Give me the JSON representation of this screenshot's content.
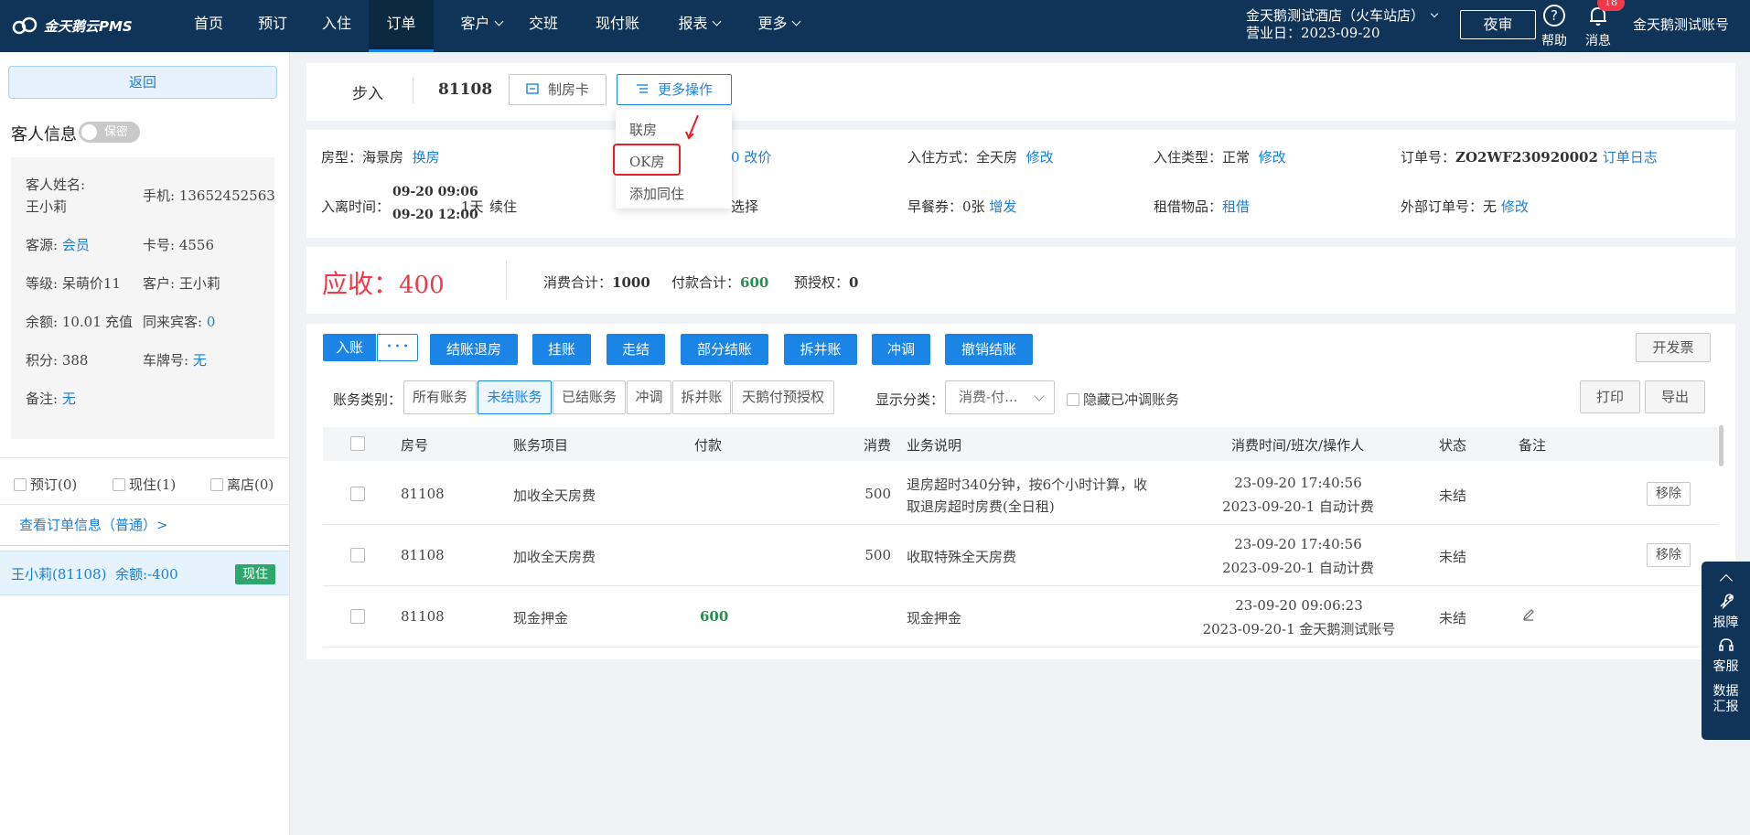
{
  "nav": {
    "logo": "金天鹅云PMS",
    "items": [
      "首页",
      "预订",
      "入住",
      "订单",
      "客户",
      "交班",
      "现付账",
      "报表",
      "更多"
    ],
    "active": "订单",
    "hotel_name": "金天鹅测试酒店（火车站店）",
    "business_date": "营业日：2023-09-20",
    "night_audit": "夜审",
    "help": "帮助",
    "messages": "消息",
    "message_count": "18",
    "account": "金天鹅测试账号"
  },
  "left": {
    "back": "返回",
    "guest_info_title": "客人信息",
    "privacy": "保密",
    "guest_name_label": "客人姓名:",
    "guest_name": "王小莉",
    "phone": "手机: 13652452563",
    "source_label": "客源:",
    "source": "会员",
    "card": "卡号: 4556",
    "level": "等级: 呆萌价11",
    "customer": "客户: 王小莉",
    "balance": "余额: 10.01",
    "recharge": "充值",
    "companions_label": "同来宾客:",
    "companions": "0",
    "points": "积分: 388",
    "plate_label": "车牌号:",
    "plate": "无",
    "remark_label": "备注:",
    "remark": "无",
    "filters": [
      "预订(0)",
      "现住(1)",
      "离店(0)"
    ],
    "view_order": "查看订单信息（普通）>",
    "room_entry": "王小莉(81108)  余额:-400",
    "room_status": "现住"
  },
  "header": {
    "walk_in": "步入",
    "room_no": "81108",
    "make_card": "制房卡",
    "more_ops": "更多操作"
  },
  "menu": {
    "items": [
      "联房",
      "OK房",
      "添加同住"
    ]
  },
  "details": {
    "room_type_label": "房型：",
    "room_type": "海景房",
    "change_room": "换房",
    "price_partial": "0",
    "change_price": "改价",
    "checkin_method_label": "入住方式：",
    "checkin_method": "全天房",
    "checkin_type_label": "入住类型：",
    "checkin_type": "正常",
    "modify": "修改",
    "order_no_label": "订单号：",
    "order_no": "ZO2WF230920002",
    "order_log": "订单日志",
    "stay_label": "入离时间：",
    "stay_in": "09-20 09:06",
    "stay_out": "09-20 12:00",
    "nights": "1天",
    "extend": "续住",
    "select": "选择",
    "breakfast_label": "早餐券：",
    "breakfast": "0张",
    "issue": "增发",
    "rental_label": "租借物品：",
    "rent": "租借",
    "external_label": "外部订单号：",
    "external": "无"
  },
  "summary": {
    "receivable_label": "应收：",
    "receivable": "400",
    "consume_label": "消费合计：",
    "consume": "1000",
    "pay_label": "付款合计：",
    "pay": "600",
    "preauth_label": "预授权：",
    "preauth": "0"
  },
  "actions": {
    "post": "入账",
    "more": "• • •",
    "buttons": [
      "结账退房",
      "挂账",
      "走结",
      "部分结账",
      "拆并账",
      "冲调",
      "撤销结账"
    ],
    "invoice": "开发票",
    "print": "打印",
    "export": "导出"
  },
  "filterbar": {
    "category_label": "账务类别：",
    "categories": [
      "所有账务",
      "未结账务",
      "已结账务",
      "冲调",
      "拆并账",
      "天鹅付预授权"
    ],
    "active_category": "未结账务",
    "display_label": "显示分类：",
    "display_value": "消费-付...",
    "hide_adjusted": "隐藏已冲调账务"
  },
  "table": {
    "headers": [
      "房号",
      "账务项目",
      "付款",
      "消费",
      "业务说明",
      "消费时间/班次/操作人",
      "状态",
      "备注"
    ],
    "rows": [
      {
        "room": "81108",
        "item": "加收全天房费",
        "pay": "",
        "consume": "500",
        "desc1": "退房超时340分钟，按6个小时计算，收",
        "desc2": "取退房超时房费(全日租)",
        "time": "23-09-20 17:40:56",
        "shift": "2023-09-20-1 自动计费",
        "status": "未结",
        "action": "移除"
      },
      {
        "room": "81108",
        "item": "加收全天房费",
        "pay": "",
        "consume": "500",
        "desc1": "收取特殊全天房费",
        "desc2": "",
        "time": "23-09-20 17:40:56",
        "shift": "2023-09-20-1 自动计费",
        "status": "未结",
        "action": "移除"
      },
      {
        "room": "81108",
        "item": "现金押金",
        "pay": "600",
        "consume": "",
        "desc1": "现金押金",
        "desc2": "",
        "time": "23-09-20 09:06:23",
        "shift": "2023-09-20-1 金天鹅测试账号",
        "status": "未结",
        "action": ""
      }
    ]
  },
  "sidebar": {
    "fault": "报障",
    "service": "客服",
    "report1": "数据",
    "report2": "汇报"
  },
  "colors": {
    "nav": "#0f3457",
    "accent": "#1b84e7",
    "danger": "#f2394a",
    "success": "#2da86a"
  }
}
